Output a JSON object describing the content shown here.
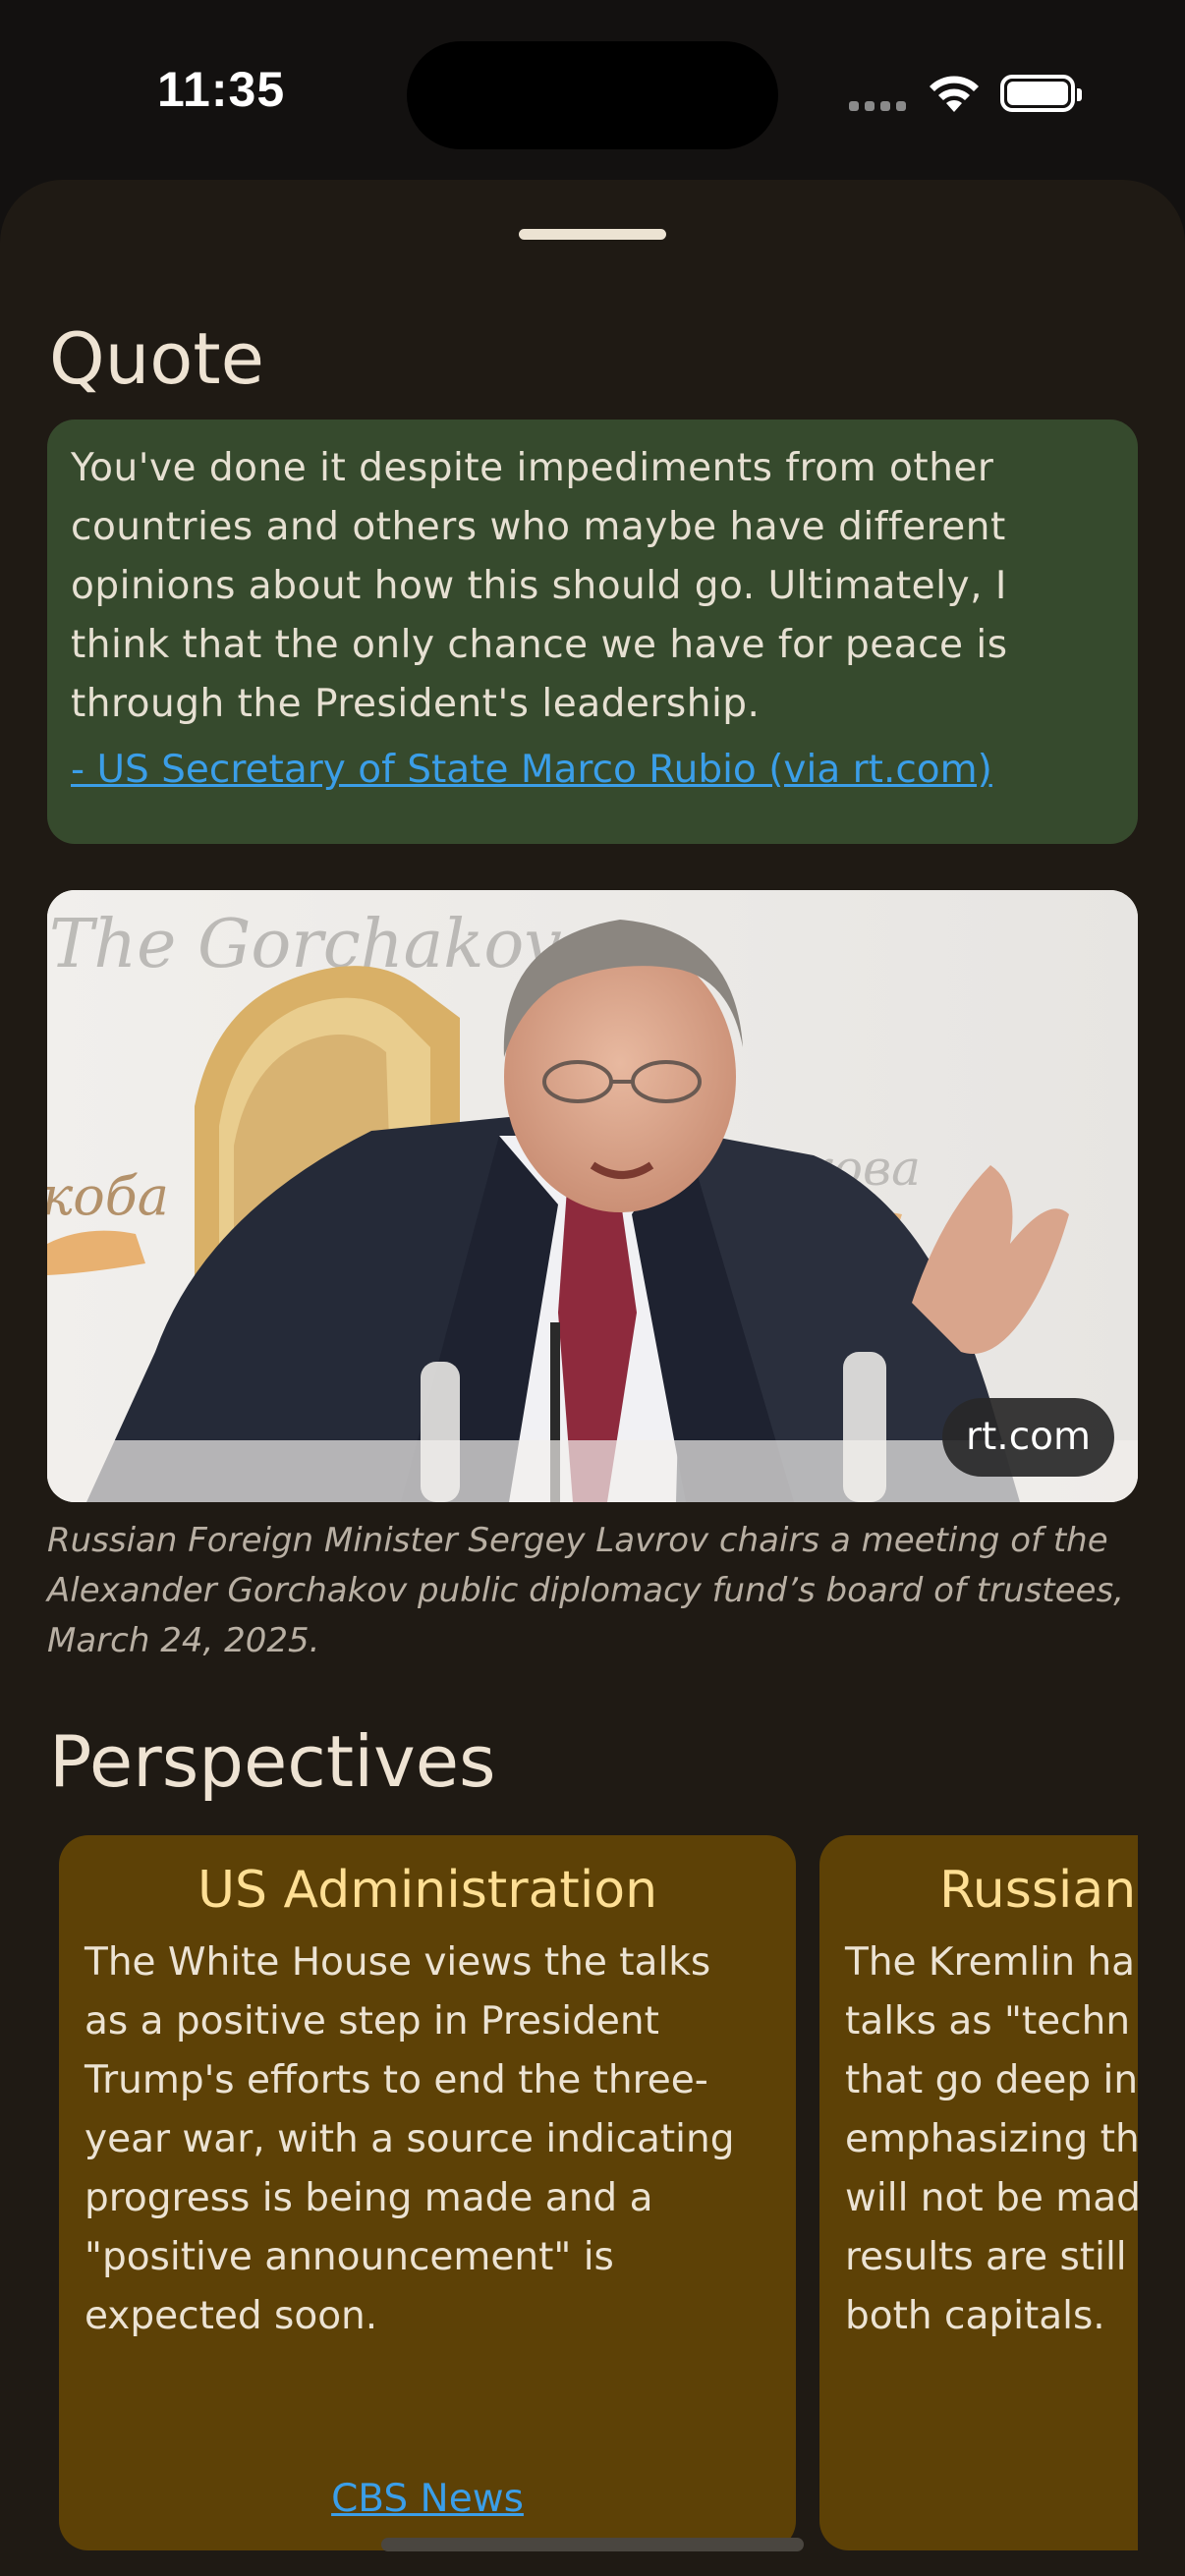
{
  "status_bar": {
    "time": "11:35"
  },
  "quote_section": {
    "title": "Quote",
    "text": "You've done it despite impediments from other countries and others who maybe have different opinions about how this should go. Ultimately, I think that the only chance we have for peace is through the President's leadership.",
    "source": "- US Secretary of State Marco Rubio (via rt.com)"
  },
  "photo": {
    "source_badge": "rt.com",
    "background_text_left": "The Gorchakov",
    "background_text_mid_left": "коба",
    "background_text_mid_right": "кова",
    "caption": "Russian Foreign Minister Sergey Lavrov chairs a meeting of the Alexander Gorchakov public diplomacy fund’s board of trustees, March 24, 2025."
  },
  "perspectives_section": {
    "title": "Perspectives",
    "cards": [
      {
        "title": "US Administration",
        "body": "The White House views the talks\nas a positive step in President\nTrump's efforts to end the three-\nyear war, with a source indicating\nprogress is being made and a\n\"positive announcement\" is\nexpected soon.",
        "source": "CBS News"
      },
      {
        "title": "Russian",
        "body": "The Kremlin ha\ntalks as \"techn\nthat go deep in\nemphasizing th\nwill not be mad\nresults are still\nboth capitals."
      }
    ]
  },
  "colors": {
    "sheet_bg": "#1f1a14",
    "quote_card": "#364a2d",
    "perspective_card": "#5d4106",
    "link": "#3b9ee8",
    "card_title": "#ffdf94"
  }
}
